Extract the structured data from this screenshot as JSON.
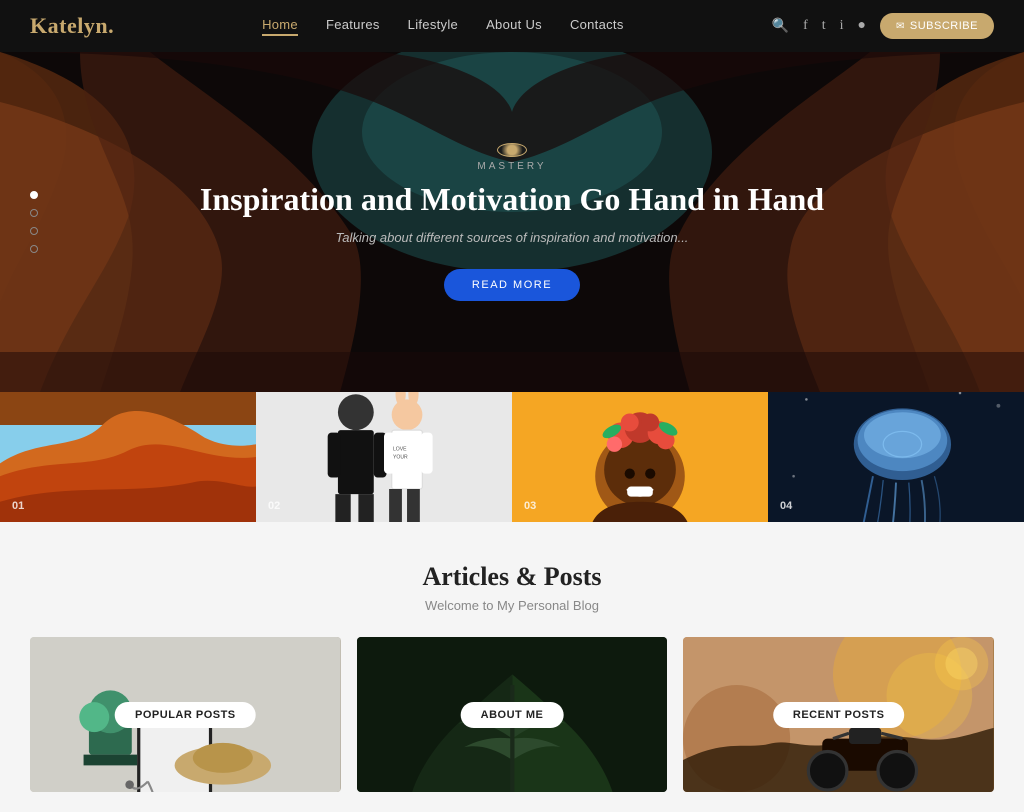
{
  "header": {
    "logo_text": "Katelyn",
    "logo_dot": ".",
    "nav": [
      {
        "label": "Home",
        "active": true
      },
      {
        "label": "Features",
        "active": false
      },
      {
        "label": "Lifestyle",
        "active": false
      },
      {
        "label": "About Us",
        "active": false
      },
      {
        "label": "Contacts",
        "active": false
      }
    ],
    "subscribe_label": "SUBSCRIBE"
  },
  "hero": {
    "tag": "MASTERY",
    "title": "Inspiration and Motivation Go Hand in Hand",
    "subtitle": "Talking about different sources of inspiration and motivation...",
    "read_more": "READ MORE",
    "slides": [
      {
        "active": true
      },
      {
        "active": false
      },
      {
        "active": false
      },
      {
        "active": false
      }
    ]
  },
  "gallery": [
    {
      "num": "01"
    },
    {
      "num": "02"
    },
    {
      "num": "03"
    },
    {
      "num": "04"
    }
  ],
  "articles": {
    "title": "Articles & Posts",
    "subtitle": "Welcome to My Personal Blog",
    "cards": [
      {
        "label": "POPULAR POSTS"
      },
      {
        "label": "ABOUT ME"
      },
      {
        "label": "RECENT POSTS"
      }
    ]
  }
}
